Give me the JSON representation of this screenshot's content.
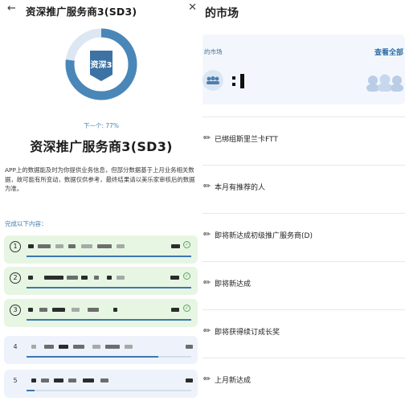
{
  "header": {
    "back_icon": "arrow-left-icon",
    "title": "资深推广服务商3(SD3)",
    "close_icon": "close-icon"
  },
  "progress": {
    "badge": "资深3",
    "next_label": "下一个: 77%",
    "percent": 77
  },
  "level_title": "资深推广服务商3(SD3)",
  "description": "APP上的数据能及时为你提供业务信息，但部分数据基于上月业务相关数据，故可能有所变动，数据仅供参考，最终结果请以美乐家审核后的数据为准。",
  "tasks_heading": "完成以下内容：",
  "tasks": [
    {
      "num": "1",
      "status": "done",
      "progress": 1.0
    },
    {
      "num": "2",
      "status": "done",
      "progress": 1.0
    },
    {
      "num": "3",
      "status": "done",
      "progress": 1.0
    },
    {
      "num": "4",
      "status": "todo",
      "progress": 0.8
    },
    {
      "num": "5",
      "status": "todo",
      "progress": 0.05
    }
  ],
  "background": {
    "title": "的市场",
    "card_label": "的市场",
    "card_link": "查看全部",
    "rows": [
      "已绑组斯里兰卡FTT",
      "本月有推荐的人",
      "即将新达成初级推广服务商(D)",
      "即将新达成",
      "即将获得续订成长奖",
      "上月新达成"
    ]
  },
  "colors": {
    "ring_fill": "#4a87b8",
    "ring_track": "#dce7f3",
    "done_bg": "#e6f6e3",
    "todo_bg": "#eef3fb",
    "accent": "#3f86b8"
  }
}
